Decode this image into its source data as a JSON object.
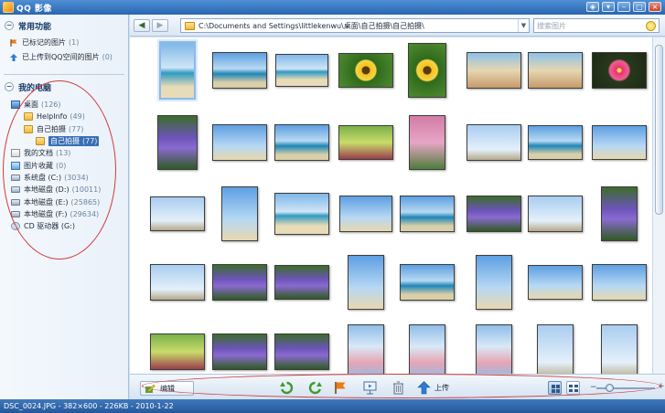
{
  "window": {
    "title": "QQ 影像"
  },
  "sidebar": {
    "common_header": "常用功能",
    "common_items": [
      {
        "label": "已标记的图片",
        "count": "(1)"
      },
      {
        "label": "已上传到QQ空间的图片",
        "count": "(0)"
      }
    ],
    "computer_header": "我的电脑",
    "tree": [
      {
        "label": "桌面",
        "count": "(126)"
      },
      {
        "label": "HelpInfo",
        "count": "(49)"
      },
      {
        "label": "自己拍摄",
        "count": "(77)"
      },
      {
        "label": "自己拍摄",
        "count": "(77)"
      },
      {
        "label": "我的文档",
        "count": "(13)"
      },
      {
        "label": "图片收藏",
        "count": "(0)"
      },
      {
        "label": "系统盘 (C:)",
        "count": "(3034)"
      },
      {
        "label": "本地磁盘 (D:)",
        "count": "(10011)"
      },
      {
        "label": "本地磁盘 (E:)",
        "count": "(25865)"
      },
      {
        "label": "本地磁盘 (F:)",
        "count": "(29634)"
      },
      {
        "label": "CD 驱动器 (G:)",
        "count": ""
      }
    ]
  },
  "toolbar": {
    "path": "C:\\Documents and Settings\\littlekenwu\\桌面\\自己拍摄\\自己拍摄\\",
    "search_placeholder": "搜索图片"
  },
  "bottombar": {
    "edit_label": "编辑",
    "upload_label": "上传"
  },
  "status": {
    "text": "DSC_0024.JPG - 382×600 - 226KB - 2010-1-22"
  },
  "colors": {
    "titlebar": "#2a66b1",
    "selection": "#3a6fb3",
    "annotation": "#d23a3a"
  }
}
